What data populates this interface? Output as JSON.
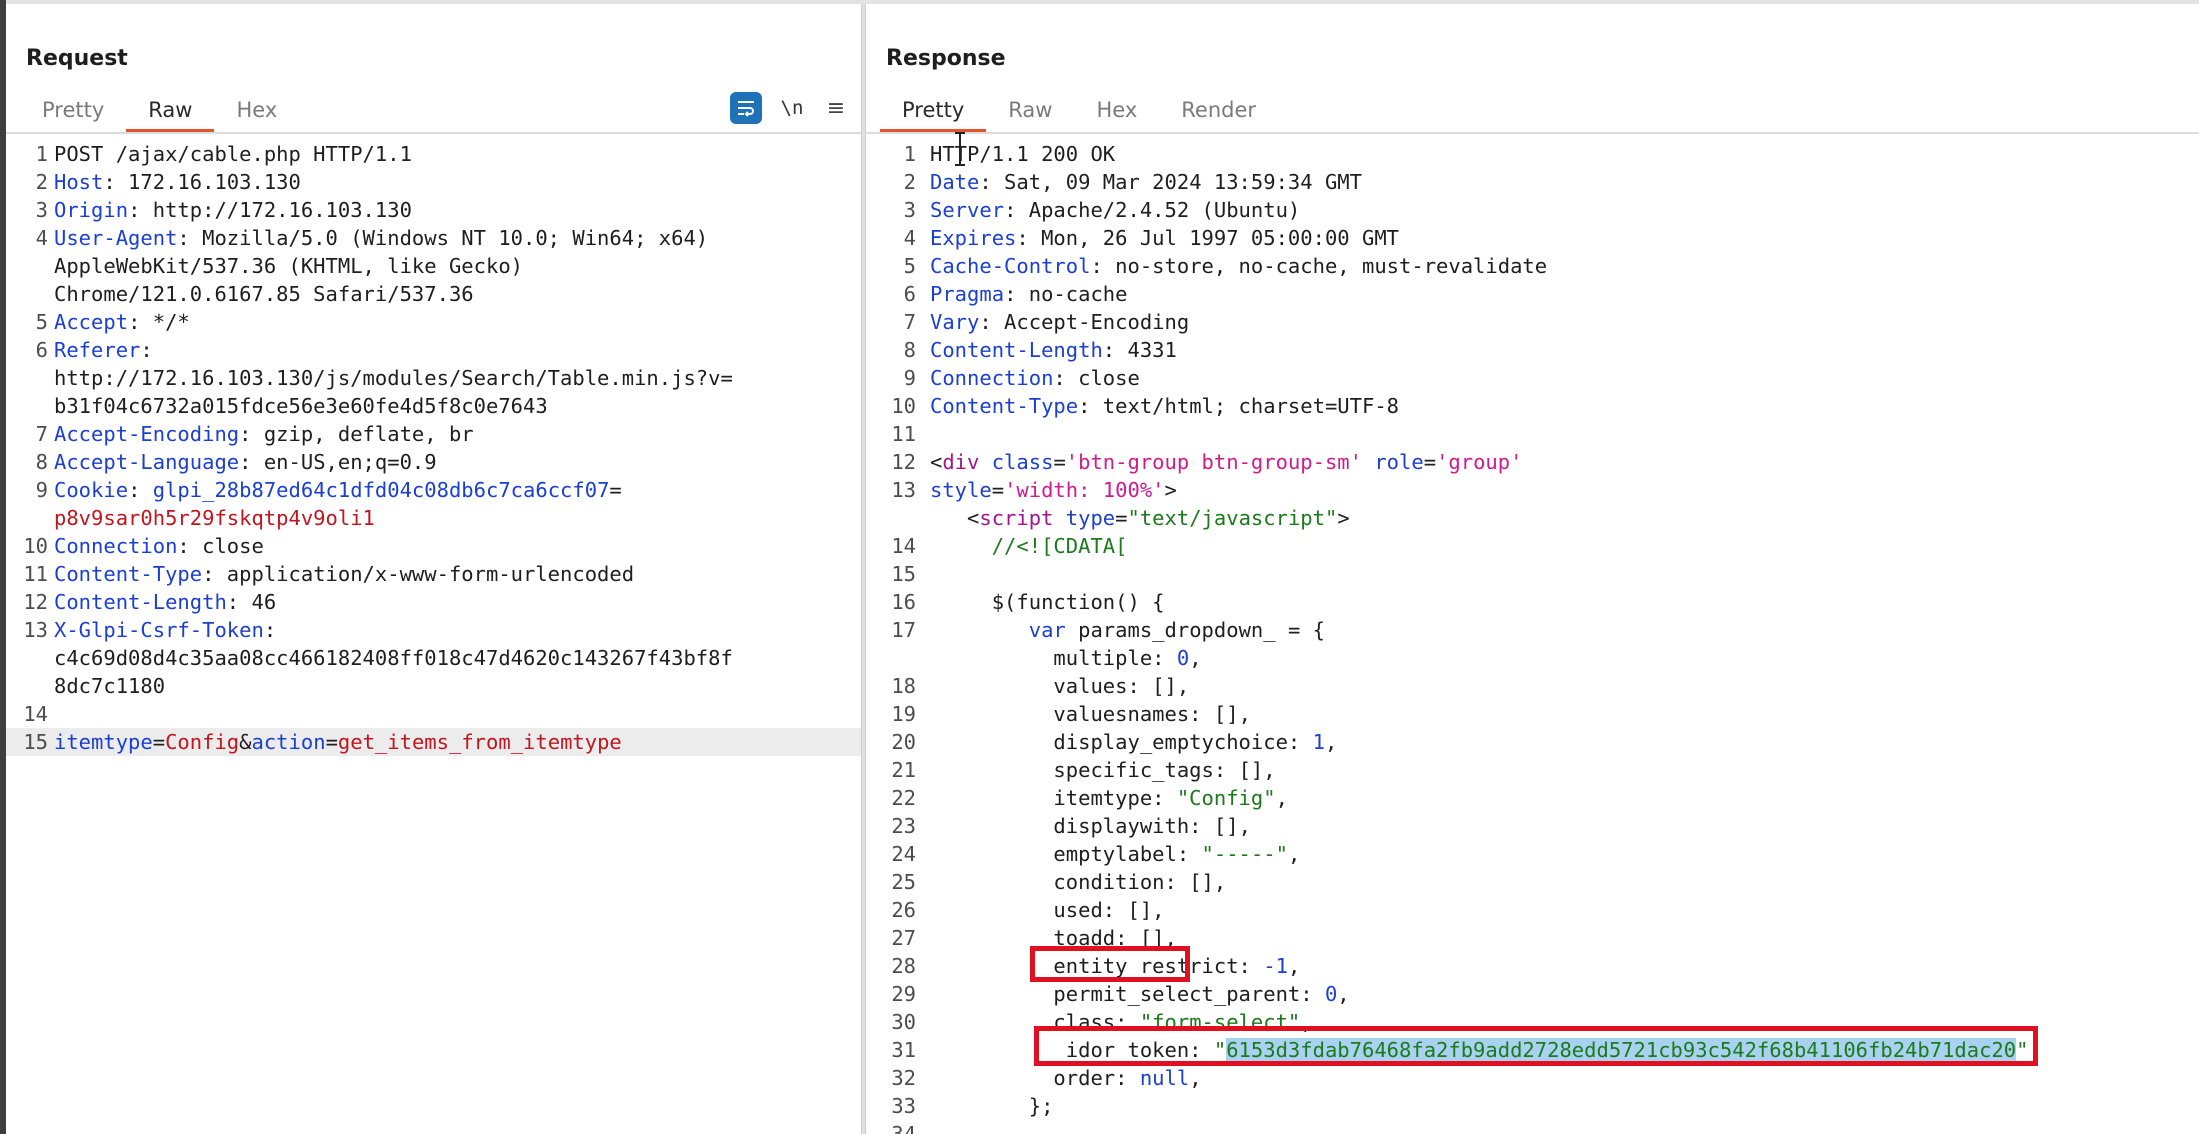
{
  "request": {
    "title": "Request",
    "tabs": [
      "Pretty",
      "Raw",
      "Hex"
    ],
    "active_tab": "Raw",
    "tools": {
      "wrap_icon": "wrap-lines-icon",
      "newline_label": "\\n",
      "menu_icon": "menu-icon"
    },
    "lines": [
      {
        "n": "1",
        "t": "POST /ajax/cable.php HTTP/1.1"
      },
      {
        "n": "2",
        "k": "Host",
        "v": "172.16.103.130"
      },
      {
        "n": "3",
        "k": "Origin",
        "v": "http://172.16.103.130"
      },
      {
        "n": "4",
        "k": "User-Agent",
        "v": "Mozilla/5.0 (Windows NT 10.0; Win64; x64)"
      },
      {
        "n": "",
        "t": "AppleWebKit/537.36 (KHTML, like Gecko)"
      },
      {
        "n": "",
        "t": "Chrome/121.0.6167.85 Safari/537.36"
      },
      {
        "n": "5",
        "k": "Accept",
        "v": "*/*"
      },
      {
        "n": "6",
        "k": "Referer",
        "v": ""
      },
      {
        "n": "",
        "t": "http://172.16.103.130/js/modules/Search/Table.min.js?v="
      },
      {
        "n": "",
        "t": "b31f04c6732a015fdce56e3e60fe4d5f8c0e7643"
      },
      {
        "n": "7",
        "k": "Accept-Encoding",
        "v": "gzip, deflate, br"
      },
      {
        "n": "8",
        "k": "Accept-Language",
        "v": "en-US,en;q=0.9"
      },
      {
        "n": "9",
        "k": "Cookie",
        "ck": "glpi_28b87ed64c1dfd04c08db6c7ca6ccf07",
        "eq": "="
      },
      {
        "n": "",
        "r": "p8v9sar0h5r29fskqtp4v9oli1"
      },
      {
        "n": "10",
        "k": "Connection",
        "v": "close"
      },
      {
        "n": "11",
        "k": "Content-Type",
        "v": "application/x-www-form-urlencoded"
      },
      {
        "n": "12",
        "k": "Content-Length",
        "v": "46"
      },
      {
        "n": "13",
        "k": "X-Glpi-Csrf-Token",
        "v": ""
      },
      {
        "n": "",
        "t": "c4c69d08d4c35aa08cc466182408ff018c47d4620c143267f43bf8f"
      },
      {
        "n": "",
        "t": "8dc7c1180"
      },
      {
        "n": "14",
        "t": ""
      },
      {
        "n": "15",
        "body": true,
        "p1k": "itemtype",
        "p1v": "Config",
        "amp": "&",
        "p2k": "action",
        "p2v": "get_items_from_itemtype"
      }
    ]
  },
  "response": {
    "title": "Response",
    "tabs": [
      "Pretty",
      "Raw",
      "Hex",
      "Render"
    ],
    "active_tab": "Pretty",
    "lines": [
      {
        "n": "1",
        "t": "HTTP/1.1 200 OK"
      },
      {
        "n": "2",
        "k": "Date",
        "v": "Sat, 09 Mar 2024 13:59:34 GMT"
      },
      {
        "n": "3",
        "k": "Server",
        "v": "Apache/2.4.52 (Ubuntu)"
      },
      {
        "n": "4",
        "k": "Expires",
        "v": "Mon, 26 Jul 1997 05:00:00 GMT"
      },
      {
        "n": "5",
        "k": "Cache-Control",
        "v": "no-store, no-cache, must-revalidate"
      },
      {
        "n": "6",
        "k": "Pragma",
        "v": "no-cache"
      },
      {
        "n": "7",
        "k": "Vary",
        "v": "Accept-Encoding"
      },
      {
        "n": "8",
        "k": "Content-Length",
        "v": "4331"
      },
      {
        "n": "9",
        "k": "Connection",
        "v": "close"
      },
      {
        "n": "10",
        "k": "Content-Type",
        "v": "text/html; charset=UTF-8"
      },
      {
        "n": "11",
        "t": ""
      },
      {
        "n": "12",
        "html": "<div class='btn-group btn-group-sm' role='group'"
      },
      {
        "n": "13",
        "html": "style='width: 100%'>"
      },
      {
        "n": "",
        "html": "   <script type=\"text/javascript\">"
      },
      {
        "n": "14",
        "cm": "     //<![CDATA["
      },
      {
        "n": "15",
        "t": ""
      },
      {
        "n": "16",
        "t": "     $(function() {"
      },
      {
        "n": "17",
        "js": "        var params_dropdown_ = {"
      },
      {
        "n": "",
        "p": "multiple",
        "val": "0",
        "ty": "num"
      },
      {
        "n": "18",
        "p": "values",
        "val": "[]",
        "ty": "plain"
      },
      {
        "n": "19",
        "p": "valuesnames",
        "val": "[]",
        "ty": "plain"
      },
      {
        "n": "20",
        "p": "display_emptychoice",
        "val": "1",
        "ty": "num"
      },
      {
        "n": "21",
        "p": "specific_tags",
        "val": "[]",
        "ty": "plain"
      },
      {
        "n": "22",
        "p": "itemtype",
        "val": "\"Config\"",
        "ty": "str"
      },
      {
        "n": "23",
        "p": "displaywith",
        "val": "[]",
        "ty": "plain"
      },
      {
        "n": "24",
        "p": "emptylabel",
        "val": "\"-----\"",
        "ty": "str"
      },
      {
        "n": "25",
        "p": "condition",
        "val": "[]",
        "ty": "plain"
      },
      {
        "n": "26",
        "p": "used",
        "val": "[]",
        "ty": "plain"
      },
      {
        "n": "27",
        "p": "toadd",
        "val": "[]",
        "ty": "plain"
      },
      {
        "n": "28",
        "p": "entity_restrict",
        "val": "-1",
        "ty": "num"
      },
      {
        "n": "29",
        "p": "permit_select_parent",
        "val": "0",
        "ty": "num"
      },
      {
        "n": "30",
        "p": "class",
        "val": "\"form-select\"",
        "ty": "str"
      },
      {
        "n": "31",
        "p": "_idor_token",
        "val": "6153d3fdab76468fa2fb9add2728edd5721cb93c542f68b41106fb24b71dac20",
        "ty": "token"
      },
      {
        "n": "32",
        "p": "order",
        "val": "null",
        "ty": "num",
        "last": true
      },
      {
        "n": "33",
        "t": "        };"
      },
      {
        "n": "34",
        "t": ""
      }
    ]
  },
  "colors": {
    "highlight_box": "#e01020",
    "tab_underline": "#e5532d",
    "key_blue": "#1b3fd1",
    "value_red": "#c0161f",
    "string_green": "#1c7a1c"
  }
}
